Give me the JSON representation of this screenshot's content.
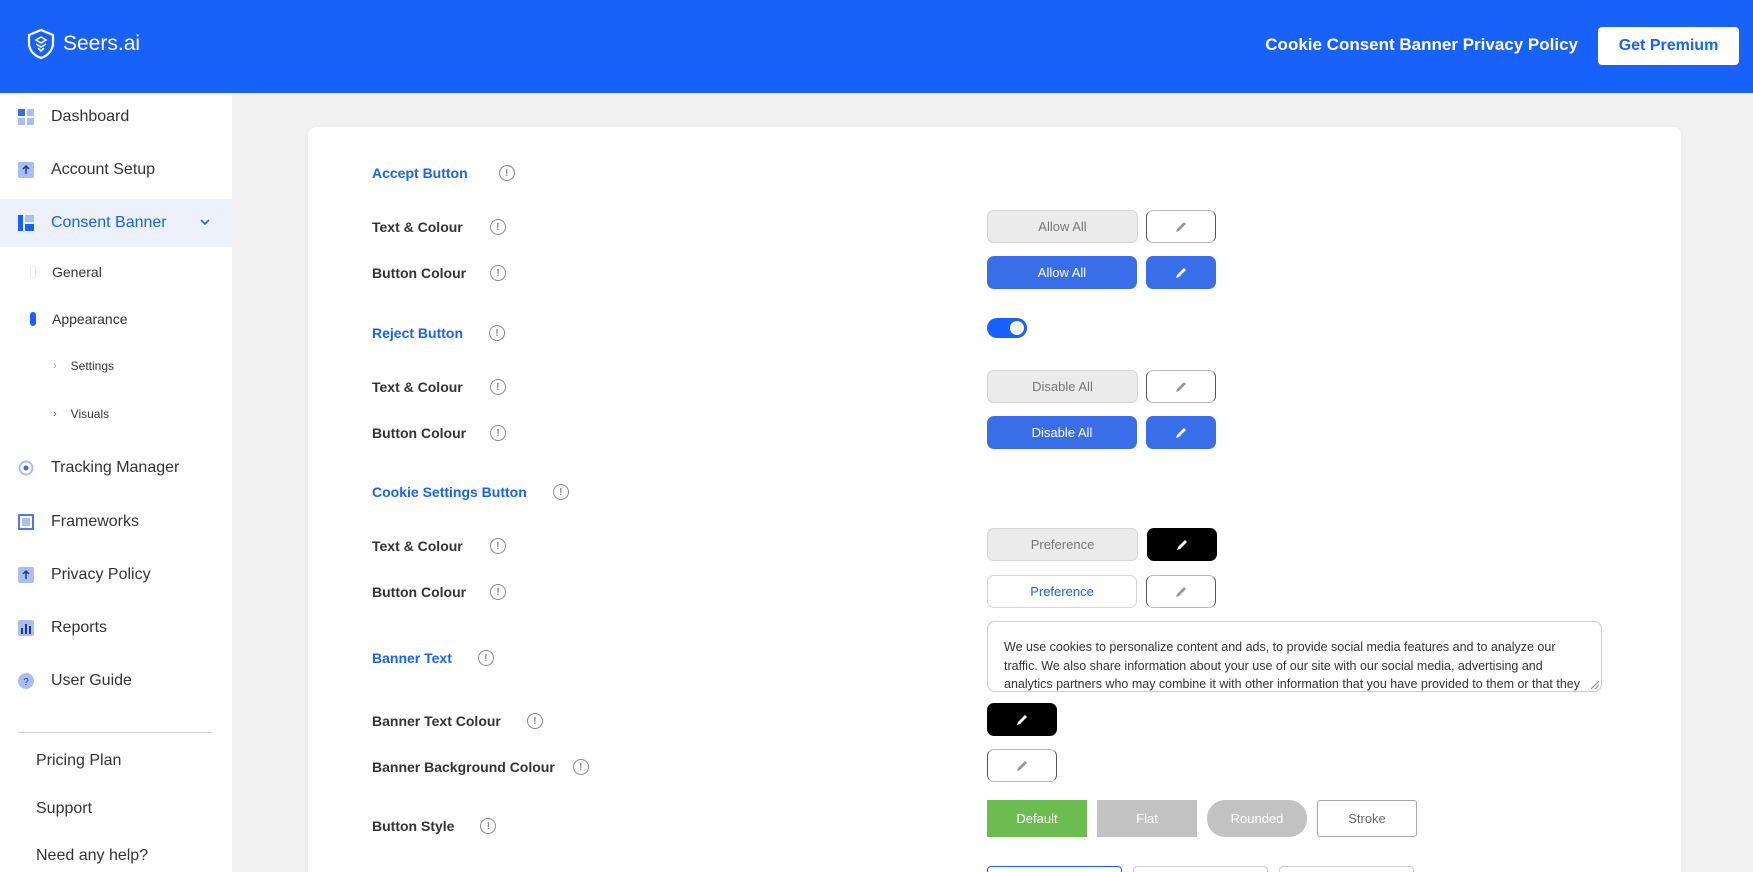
{
  "header": {
    "logo_text": "Seers.ai",
    "link": "Cookie Consent Banner Privacy Policy",
    "premium_button": "Get Premium"
  },
  "sidebar": {
    "items": [
      {
        "label": "Dashboard",
        "icon": "dashboard-icon"
      },
      {
        "label": "Account Setup",
        "icon": "account-setup-icon"
      },
      {
        "label": "Consent Banner",
        "icon": "consent-banner-icon",
        "expanded": true
      },
      {
        "label": "Tracking Manager",
        "icon": "tracking-manager-icon"
      },
      {
        "label": "Frameworks",
        "icon": "frameworks-icon"
      },
      {
        "label": "Privacy Policy",
        "icon": "privacy-policy-icon"
      },
      {
        "label": "Reports",
        "icon": "reports-icon"
      },
      {
        "label": "User Guide",
        "icon": "user-guide-icon"
      }
    ],
    "sub_items": [
      {
        "label": "General",
        "active": false
      },
      {
        "label": "Appearance",
        "active": true
      }
    ],
    "subsub_items": [
      {
        "label": "Settings"
      },
      {
        "label": "Visuals"
      }
    ],
    "footer_links": [
      "Pricing Plan",
      "Support",
      "Need any help?"
    ]
  },
  "main": {
    "accept_section": "Accept Button",
    "reject_section": "Reject Button",
    "cookie_settings_section": "Cookie Settings Button",
    "banner_text_label": "Banner Text",
    "text_colour_label": "Text & Colour",
    "button_colour_label": "Button Colour",
    "banner_text_colour_label": "Banner Text Colour",
    "banner_bg_colour_label": "Banner Background Colour",
    "button_style_label": "Button Style",
    "accept_text": "Allow All",
    "accept_button": "Allow All",
    "reject_text": "Disable All",
    "reject_button": "Disable All",
    "reject_enabled": true,
    "preference_text": "Preference",
    "preference_button": "Preference",
    "banner_text": "We use cookies to personalize content and ads, to provide social media features and to analyze our traffic. We also share information about your use of our site with our social media, advertising and analytics partners who may combine it with other information that you have provided to them or that they have collected from your use of their services.",
    "button_styles": [
      "Default",
      "Flat",
      "Rounded",
      "Stroke"
    ],
    "selected_style": "Default"
  },
  "colors": {
    "brand": "#1862f9",
    "button_blue": "#3a6ee8",
    "default_green": "#6cbd4f"
  }
}
